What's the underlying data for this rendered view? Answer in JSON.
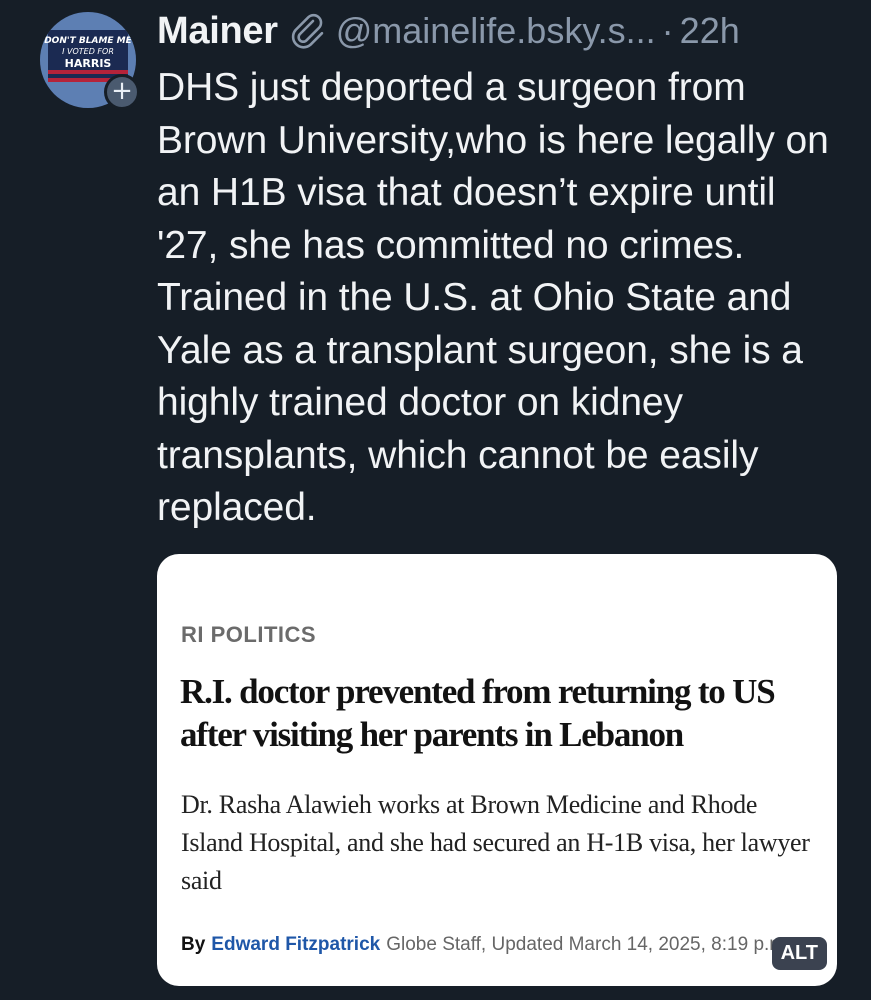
{
  "post": {
    "author_display_name": "Mainer",
    "author_handle": "@mainelife.bsky.s...",
    "separator": "·",
    "timestamp": "22h",
    "avatar": {
      "icon": "flag-avatar",
      "flag_text_line1": "DON'T BLAME ME",
      "flag_text_line2": "I VOTED FOR",
      "flag_text_line3": "HARRIS"
    },
    "follow_icon": "+",
    "badge_icon": "paperclip-icon",
    "text": "DHS just deported a surgeon from Brown University,who is here legally on an H1B visa that doesn’t expire until '27, she has committed no crimes. Trained in the U.S. at Ohio State and Yale as a transplant surgeon, she is a highly trained doctor on kidney transplants, which cannot be easily replaced."
  },
  "embed": {
    "section": "RI POLITICS",
    "headline": "R.I. doctor prevented from returning to US after visiting her parents in Lebanon",
    "summary": "Dr. Rasha Alawieh works at Brown Medicine and Rhode Island Hospital, and she had secured an H-1B visa, her lawyer said",
    "byline_prefix": "By",
    "byline_author": "Edward Fitzpatrick",
    "byline_meta": "Globe Staff, Updated March 14, 2025, 8:19 p.m.",
    "alt_label": "ALT"
  },
  "colors": {
    "background": "#161e27",
    "text_primary": "#f1f3f5",
    "text_secondary": "#8a98aa",
    "link_blue": "#1f57a8",
    "card_bg": "#ffffff"
  }
}
